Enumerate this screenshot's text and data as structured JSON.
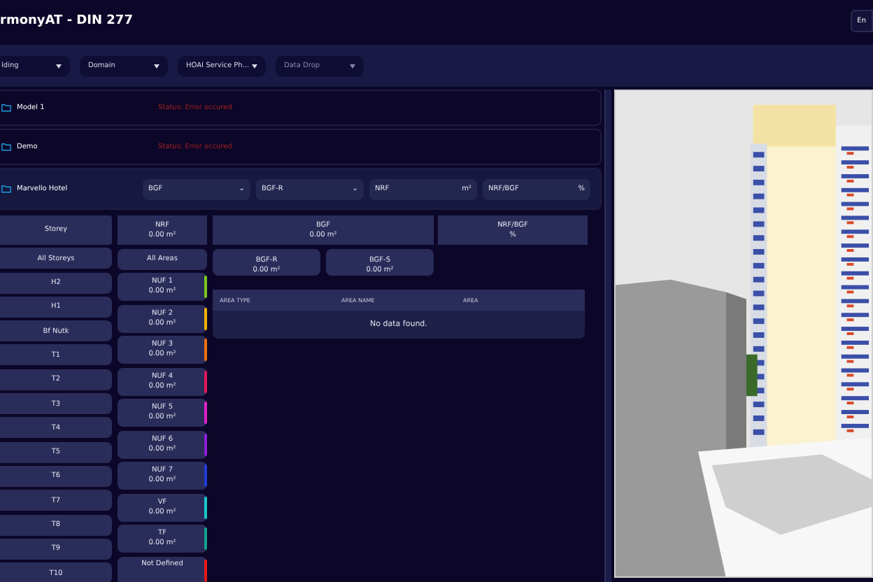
{
  "header": {
    "title": "rmonyAT - DIN 277",
    "button": "En"
  },
  "filters": [
    {
      "label": "lding",
      "dim": false
    },
    {
      "label": "Domain",
      "dim": false
    },
    {
      "label": "HOAI Service Ph...",
      "dim": false
    },
    {
      "label": "Data Drop",
      "dim": true
    }
  ],
  "models": [
    {
      "name": "Model 1",
      "selected": false,
      "status": "Status: Error occured"
    },
    {
      "name": "Demo",
      "selected": false,
      "status": "Status: Error occured"
    },
    {
      "name": "Marvello Hotel",
      "selected": true,
      "selects": [
        {
          "label": "BGF",
          "suffix": "⌄"
        },
        {
          "label": "BGF-R",
          "suffix": "⌄"
        },
        {
          "label": "NRF",
          "suffix": "m²"
        },
        {
          "label": "NRF/BGF",
          "suffix": "%"
        }
      ]
    }
  ],
  "storey": {
    "header": "Storey",
    "items": [
      {
        "label": "All Storeys"
      },
      {
        "label": "H2"
      },
      {
        "label": "H1"
      },
      {
        "label": "Bf Nutk"
      },
      {
        "label": "T1"
      },
      {
        "label": "T2"
      },
      {
        "label": "T3"
      },
      {
        "label": "T4"
      },
      {
        "label": "T5"
      },
      {
        "label": "T6"
      },
      {
        "label": "T7"
      },
      {
        "label": "T8"
      },
      {
        "label": "T9"
      },
      {
        "label": "T10"
      }
    ]
  },
  "nrf": {
    "header": "NRF",
    "value": "0.00 m²",
    "items": [
      {
        "label": "All Areas"
      },
      {
        "label": "NUF 1",
        "value": "0.00 m²",
        "color": "#7ec81e"
      },
      {
        "label": "NUF 2",
        "value": "0.00 m²",
        "color": "#f0b400"
      },
      {
        "label": "NUF 3",
        "value": "0.00 m²",
        "color": "#f07010"
      },
      {
        "label": "NUF 4",
        "value": "0.00 m²",
        "color": "#e8185a"
      },
      {
        "label": "NUF 5",
        "value": "0.00 m²",
        "color": "#e01ec8"
      },
      {
        "label": "NUF 6",
        "value": "0.00 m²",
        "color": "#8c1ed8"
      },
      {
        "label": "NUF 7",
        "value": "0.00 m²",
        "color": "#1e3cd8"
      },
      {
        "label": "VF",
        "value": "0.00 m²",
        "color": "#18c8c8"
      },
      {
        "label": "TF",
        "value": "0.00 m²",
        "color": "#14a08c"
      },
      {
        "label": "Not Defined",
        "color": "#e81818"
      }
    ]
  },
  "bgf": {
    "label": "BGF",
    "value": "0.00 m²"
  },
  "ratio": {
    "label": "NRF/BGF",
    "value": "%"
  },
  "sub": [
    {
      "label": "BGF-R",
      "value": "0.00 m²"
    },
    {
      "label": "BGF-S",
      "value": "0.00 m²"
    }
  ],
  "table": {
    "columns": [
      "AREA TYPE",
      "AREA NAME",
      "AREA"
    ],
    "empty": "No data found."
  }
}
